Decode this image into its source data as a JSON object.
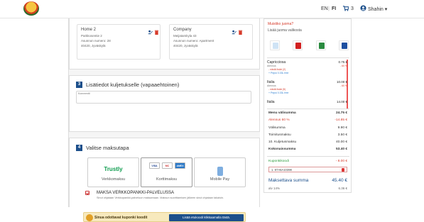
{
  "header": {
    "lang_en": "EN",
    "lang_sep": "|",
    "lang_fi": "FI",
    "cart_count": "3",
    "user_name": "Shahin ▾"
  },
  "addresses": [
    {
      "name": "Home 2",
      "line1": "Parkkosentie 2",
      "line2": "Asunnon numero: 28",
      "line3": "40420, Jyväskylä"
    },
    {
      "name": "Company",
      "line1": "Meijatamkyla 43",
      "line2": "Asunnon numero: Apartment",
      "line3": "40420, Jyväskylä"
    }
  ],
  "step3": {
    "number": "3",
    "title": "Lisätiedot kuljetukselle (vapaaehtoinen)",
    "comment_label": "Kommentti"
  },
  "step4": {
    "number": "4",
    "title": "Valitse maksutapa"
  },
  "payment": {
    "trustly_logo": "Trustly",
    "online_label": "Verkkomaksu",
    "card_label": "Korttimaksu",
    "card_brands": [
      "VISA",
      "MC",
      "AMEX"
    ],
    "mobile_label": "Mobile Pay",
    "bank_title": "MAKSA VERKKOPANKKI-PALVELUSSA",
    "bank_desc": "Sinut ohjataan Verkkopankki-palveluun maksamaan. Maksun suorittamisen jälkeen sinut ohjataan takaisin."
  },
  "coupon_banner": {
    "text": "Sinua odottavat kuponki koodit",
    "button": "Lisää etukoodi klikkaamalla tästä."
  },
  "sidebar": {
    "header": "Muistiko juoma?",
    "sub": "Lisää juoma valikosta",
    "beverages": [
      "water-icon",
      "cola-icon",
      "sprite-icon",
      "pepsi-icon"
    ],
    "order": [
      {
        "name": "Capricciosa",
        "price": "0.75 €",
        "sub": "Alennus",
        "red": "- nästä lisää (2)",
        "red_price": "- 60 %",
        "blue": "+ Pepsi 0.33L free"
      },
      {
        "name": "Italia",
        "price": "10.00 €",
        "sub": "Alennus",
        "red": "- nästä lisää (5)",
        "red_price": "- 60 %",
        "blue": "+ Pepsi 0.33L free"
      },
      {
        "name": "Italia",
        "price": "14.00 €",
        "sub": "",
        "red": "",
        "red_price": "",
        "blue": ""
      }
    ],
    "summary": [
      {
        "label": "Menu välisumma",
        "value": "24.75 €",
        "bold": true,
        "color": ""
      },
      {
        "label": "Alennus 60 %",
        "value": "-14.85 €",
        "bold": false,
        "color": "#d63b2b"
      },
      {
        "label": "Välisumma",
        "value": "9.90 €",
        "bold": false,
        "color": ""
      },
      {
        "label": "Toimitusmaksu",
        "value": "3.50 €",
        "bold": false,
        "color": ""
      },
      {
        "label": "10. Kuljetusmaksu",
        "value": "40.00 €",
        "bold": false,
        "color": ""
      },
      {
        "label": "Kokonaissumma",
        "value": "53.40 €",
        "bold": true,
        "color": ""
      }
    ],
    "coupon_label": "Kuponkikoodi",
    "coupon_value": "- 8.00 €",
    "coupon_code": "1. 87A6A10398",
    "total_label": "Maksettava summa",
    "total_value": "45.40 €",
    "vat_label": "alv 14%",
    "vat_value": "6.36 €"
  },
  "colors": {
    "primary": "#1c4f8b",
    "danger": "#d63b2b",
    "trustly": "#0e9c4e"
  }
}
